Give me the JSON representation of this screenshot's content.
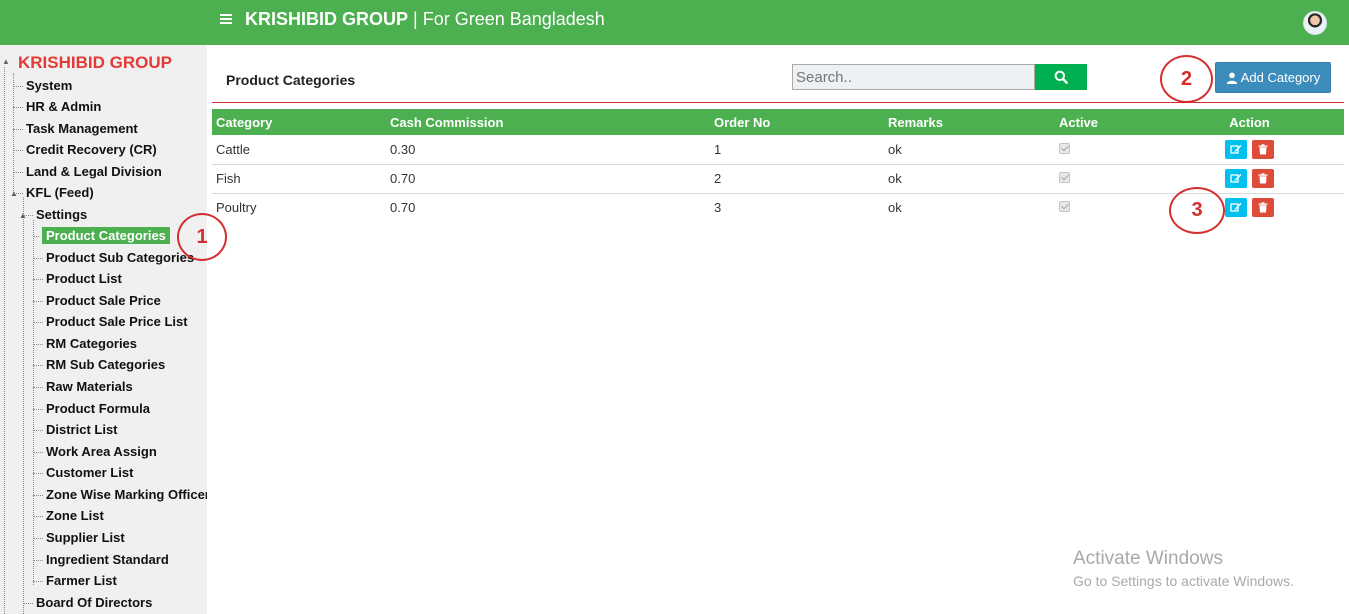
{
  "header": {
    "brand_bold": "KRISHIBID GROUP",
    "brand_rest": " | For Green Bangladesh",
    "bg_color": "#4caf50"
  },
  "sidebar": {
    "root": "KRISHIBID GROUP",
    "top_items": [
      "System",
      "HR & Admin",
      "Task Management",
      "Credit Recovery (CR)",
      "Land & Legal Division",
      "KFL (Feed)"
    ],
    "settings_label": "Settings",
    "settings_items": [
      "Product Categories",
      "Product Sub Categories",
      "Product List",
      "Product Sale Price",
      "Product Sale Price List",
      "RM Categories",
      "RM Sub Categories",
      "Raw Materials",
      "Product Formula",
      "District List",
      "Work Area Assign",
      "Customer List",
      "Zone Wise Marking Officer",
      "Zone List",
      "Supplier List",
      "Ingredient Standard",
      "Farmer List"
    ],
    "active_item": "Product Categories",
    "bottom_item": "Board Of Directors"
  },
  "main": {
    "title": "Product Categories",
    "search_placeholder": "Search..",
    "add_button_label": "Add Category",
    "columns": [
      "Category",
      "Cash Commission",
      "Order No",
      "Remarks",
      "Active",
      "Action"
    ],
    "rows": [
      {
        "category": "Cattle",
        "cash_commission": "0.30",
        "order_no": "1",
        "remarks": "ok",
        "active": true
      },
      {
        "category": "Fish",
        "cash_commission": "0.70",
        "order_no": "2",
        "remarks": "ok",
        "active": true
      },
      {
        "category": "Poultry",
        "cash_commission": "0.70",
        "order_no": "3",
        "remarks": "ok",
        "active": true
      }
    ]
  },
  "annotations": [
    "1",
    "2",
    "3"
  ],
  "watermark": {
    "line1": "Activate Windows",
    "line2": "Go to Settings to activate Windows."
  },
  "icons": {
    "menu": "hamburger-icon",
    "search": "search-icon",
    "add": "user-icon",
    "edit": "edit-icon",
    "delete": "trash-icon"
  },
  "colors": {
    "accent_green": "#4caf50",
    "search_green": "#00b050",
    "brand_red": "#e53935",
    "primary_blue": "#3c8dbc",
    "edit_cyan": "#00c0ef",
    "delete_red": "#dd4b39"
  }
}
